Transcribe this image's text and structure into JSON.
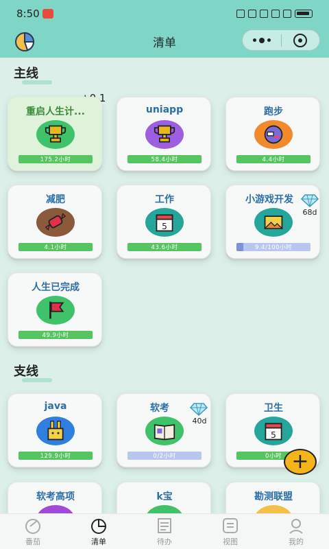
{
  "status_bar": {
    "time": "8:50"
  },
  "header": {
    "title": "清单"
  },
  "sections": {
    "main": {
      "title": "主线"
    },
    "side": {
      "title": "支线"
    }
  },
  "floating_plus": "+0.1",
  "main_cards": [
    {
      "name": "重启人生计...",
      "progress": "175.2小时",
      "icon": "trophy-icon",
      "accent": "#3fc26a"
    },
    {
      "name": "uniapp",
      "progress": "58.4小时",
      "icon": "trophy-icon",
      "accent": "#9b5fe0"
    },
    {
      "name": "跑步",
      "progress": "4.4小时",
      "icon": "ball-icon",
      "accent": "#f08a2c"
    },
    {
      "name": "减肥",
      "progress": "4.1小时",
      "icon": "candy-icon",
      "accent": "#8a5a3a"
    },
    {
      "name": "工作",
      "progress": "43.6小时",
      "icon": "calendar-icon",
      "accent": "#26a69a"
    },
    {
      "name": "小游戏开发",
      "progress": "9.4/100小时",
      "progress_fraction": 0.094,
      "badge": "68d",
      "icon": "picture-icon",
      "accent": "#26a69a"
    },
    {
      "name": "人生已完成",
      "progress": "49.9小时",
      "icon": "flag-icon",
      "accent": "#3fc26a"
    }
  ],
  "side_cards": [
    {
      "name": "java",
      "progress": "129.9小时",
      "icon": "rabbit-icon",
      "accent": "#2f7fe0"
    },
    {
      "name": "软考",
      "progress": "0/2小时",
      "progress_fraction": 0,
      "badge": "40d",
      "icon": "book-icon",
      "accent": "#3fc26a"
    },
    {
      "name": "卫生",
      "progress": "0小时",
      "icon": "calendar-icon",
      "accent": "#26a69a"
    },
    {
      "name": "软考高项",
      "icon": "grid-icon"
    },
    {
      "name": "k宝",
      "icon": "box-icon"
    },
    {
      "name": "勘测联盟",
      "icon": "face-icon"
    }
  ],
  "tabs": [
    {
      "label": "番茄",
      "icon": "tomato-icon"
    },
    {
      "label": "清单",
      "icon": "pie-icon"
    },
    {
      "label": "待办",
      "icon": "checklist-icon"
    },
    {
      "label": "视图",
      "icon": "view-icon"
    },
    {
      "label": "我的",
      "icon": "user-icon"
    }
  ]
}
